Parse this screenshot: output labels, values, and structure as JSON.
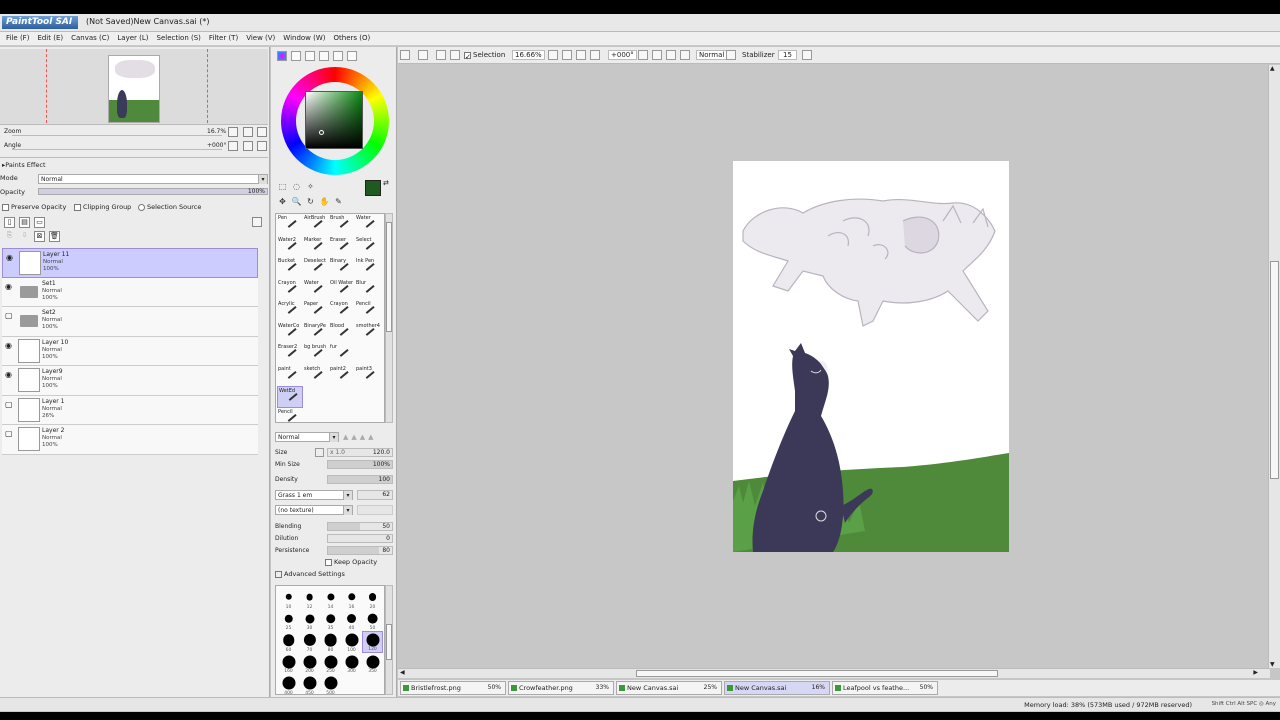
{
  "app": {
    "logo": "PaintTool SAI",
    "window_title": "(Not Saved)New Canvas.sai (*)"
  },
  "menu": [
    "File (F)",
    "Edit (E)",
    "Canvas (C)",
    "Layer (L)",
    "Selection (S)",
    "Filter (T)",
    "View (V)",
    "Window (W)",
    "Others (O)"
  ],
  "navigator": {
    "zoom_label": "Zoom",
    "zoom_value": "16.7%",
    "angle_label": "Angle",
    "angle_value": "+000°"
  },
  "paint_effect": {
    "header": "Paints Effect",
    "mode_label": "Mode",
    "mode_value": "Normal",
    "opacity_label": "Opacity",
    "opacity_value": "100%",
    "preserve_opacity": "Preserve Opacity",
    "clipping_group": "Clipping Group",
    "selection_source": "Selection Source"
  },
  "layers": [
    {
      "name": "Layer 11",
      "mode": "Normal",
      "opacity": "100%",
      "type": "layer",
      "selected": true,
      "visible": true
    },
    {
      "name": "Set1",
      "mode": "Normal",
      "opacity": "100%",
      "type": "folder",
      "selected": false,
      "visible": true
    },
    {
      "name": "Set2",
      "mode": "Normal",
      "opacity": "100%",
      "type": "folder",
      "selected": false,
      "visible": false
    },
    {
      "name": "Layer 10",
      "mode": "Normal",
      "opacity": "100%",
      "type": "layer",
      "selected": false,
      "visible": true
    },
    {
      "name": "Layer9",
      "mode": "Normal",
      "opacity": "100%",
      "type": "layer",
      "selected": false,
      "visible": true
    },
    {
      "name": "Layer 1",
      "mode": "Normal",
      "opacity": "26%",
      "type": "layer",
      "selected": false,
      "visible": false
    },
    {
      "name": "Layer 2",
      "mode": "Normal",
      "opacity": "100%",
      "type": "layer",
      "selected": false,
      "visible": false
    }
  ],
  "colors": {
    "foreground": "#1f5a1f",
    "background": "#ffffff"
  },
  "brushes": [
    "Pen",
    "AirBrush",
    "Brush",
    "Water",
    "Water2",
    "Marker",
    "Eraser",
    "Select",
    "Bucket",
    "Deselect",
    "Binary",
    "Ink Pen",
    "Crayon",
    "Water",
    "Oil Water",
    "Blur",
    "Acrylic",
    "Paper",
    "Crayon",
    "Pencil",
    "WaterCo",
    "BinaryPe",
    "Blood",
    "smother4",
    "Eraser2",
    "bg brush",
    "fur",
    "",
    "paint",
    "sketch",
    "paint2",
    "paint3",
    "WetEd",
    "",
    "",
    "",
    "Pencil",
    "",
    "",
    ""
  ],
  "selected_brush_index": 32,
  "brush_settings": {
    "mode": "Normal",
    "size_label": "Size",
    "size_mult": "x 1.0",
    "size_value": "120.0",
    "min_size_label": "Min Size",
    "min_size_value": "100%",
    "density_label": "Density",
    "density_value": "100",
    "shape": "Grass 1 em",
    "shape_value": "62",
    "texture": "(no texture)",
    "blending_label": "Blending",
    "blending_value": "50",
    "dilution_label": "Dilution",
    "dilution_value": "0",
    "persistence_label": "Persistence",
    "persistence_value": "80",
    "keep_opacity": "Keep Opacity",
    "advanced_settings": "Advanced Settings"
  },
  "brush_tips": [
    "10",
    "12",
    "14",
    "16",
    "20",
    "25",
    "30",
    "35",
    "40",
    "50",
    "60",
    "70",
    "80",
    "100",
    "120",
    "160",
    "200",
    "250",
    "300",
    "350",
    "400",
    "450",
    "500"
  ],
  "selected_tip": "120",
  "toolbar": {
    "selection_label": "Selection",
    "zoom_value": "16.66%",
    "angle_value": "+000°",
    "blend_mode": "Normal",
    "stabilizer_label": "Stabilizer",
    "stabilizer_value": "15"
  },
  "tabs": [
    {
      "name": "Bristlefrost.png",
      "zoom": "50%",
      "active": false
    },
    {
      "name": "Crowfeather.png",
      "zoom": "33%",
      "active": false
    },
    {
      "name": "New Canvas.sai",
      "zoom": "25%",
      "active": false
    },
    {
      "name": "New Canvas.sai",
      "zoom": "16%",
      "active": true
    },
    {
      "name": "Leafpool vs feathe...",
      "zoom": "50%",
      "active": false
    }
  ],
  "status": {
    "memory": "Memory load: 38% (573MB used / 972MB reserved)",
    "keys": "Shift Ctrl Alt SPC ◎ Any"
  }
}
